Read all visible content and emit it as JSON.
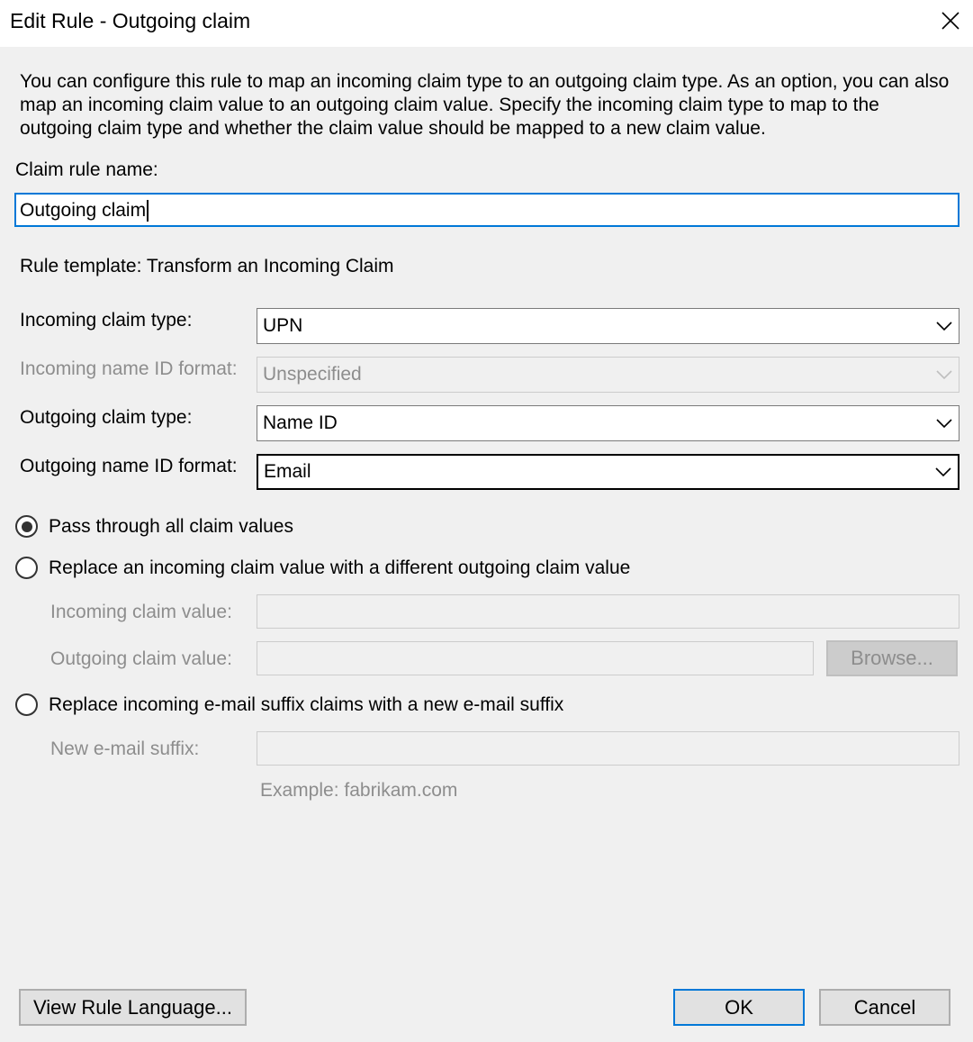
{
  "window": {
    "title": "Edit Rule - Outgoing claim",
    "close_icon": "close-icon"
  },
  "description": "You can configure this rule to map an incoming claim type to an outgoing claim type. As an option, you can also map an incoming claim value to an outgoing claim value. Specify the incoming claim type to map to the outgoing claim type and whether the claim value should be mapped to a new claim value.",
  "rule_name": {
    "label": "Claim rule name:",
    "value": "Outgoing claim"
  },
  "rule_template": "Rule template: Transform an Incoming Claim",
  "fields": {
    "incoming_claim_type": {
      "label": "Incoming claim type:",
      "value": "UPN"
    },
    "incoming_name_id_format": {
      "label": "Incoming name ID format:",
      "value": "Unspecified"
    },
    "outgoing_claim_type": {
      "label": "Outgoing claim type:",
      "value": "Name ID"
    },
    "outgoing_name_id_format": {
      "label": "Outgoing name ID format:",
      "value": "Email"
    }
  },
  "options": {
    "pass_through": {
      "label": "Pass through all claim values",
      "selected": true
    },
    "replace_value": {
      "label": "Replace an incoming claim value with a different outgoing claim value",
      "selected": false
    },
    "replace_suffix": {
      "label": "Replace incoming e-mail suffix claims with a new e-mail suffix",
      "selected": false
    }
  },
  "replace_value_fields": {
    "incoming_label": "Incoming claim value:",
    "outgoing_label": "Outgoing claim value:",
    "browse_label": "Browse..."
  },
  "suffix_fields": {
    "label": "New e-mail suffix:",
    "example": "Example: fabrikam.com"
  },
  "buttons": {
    "view_rule_language": "View Rule Language...",
    "ok": "OK",
    "cancel": "Cancel"
  },
  "colors": {
    "focus": "#0078d7",
    "background": "#f0f0f0",
    "disabled_text": "#8d8d8d"
  }
}
